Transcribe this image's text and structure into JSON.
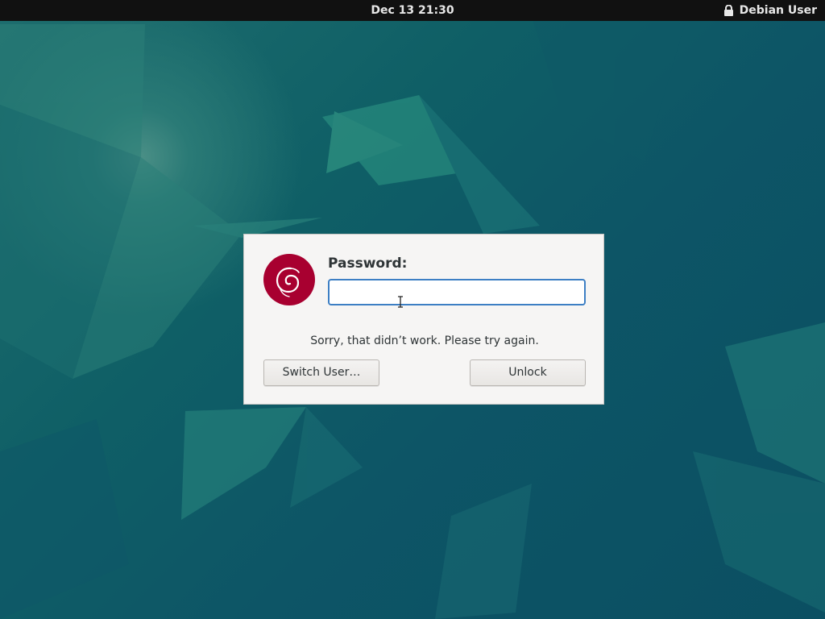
{
  "topbar": {
    "clock": "Dec 13  21:30",
    "user_name": "Debian User",
    "lock_icon": "lock-icon"
  },
  "dialog": {
    "avatar_icon": "debian-swirl-icon",
    "password_label": "Password:",
    "password_value": "",
    "error_message": "Sorry, that didn’t work. Please try again.",
    "switch_user_label": "Switch User…",
    "unlock_label": "Unlock"
  },
  "colors": {
    "topbar_bg": "#111111",
    "dialog_bg": "#f6f5f4",
    "avatar_bg": "#a80030",
    "focus_border": "#3d7fc4",
    "wallpaper_base": "#0d5566"
  }
}
